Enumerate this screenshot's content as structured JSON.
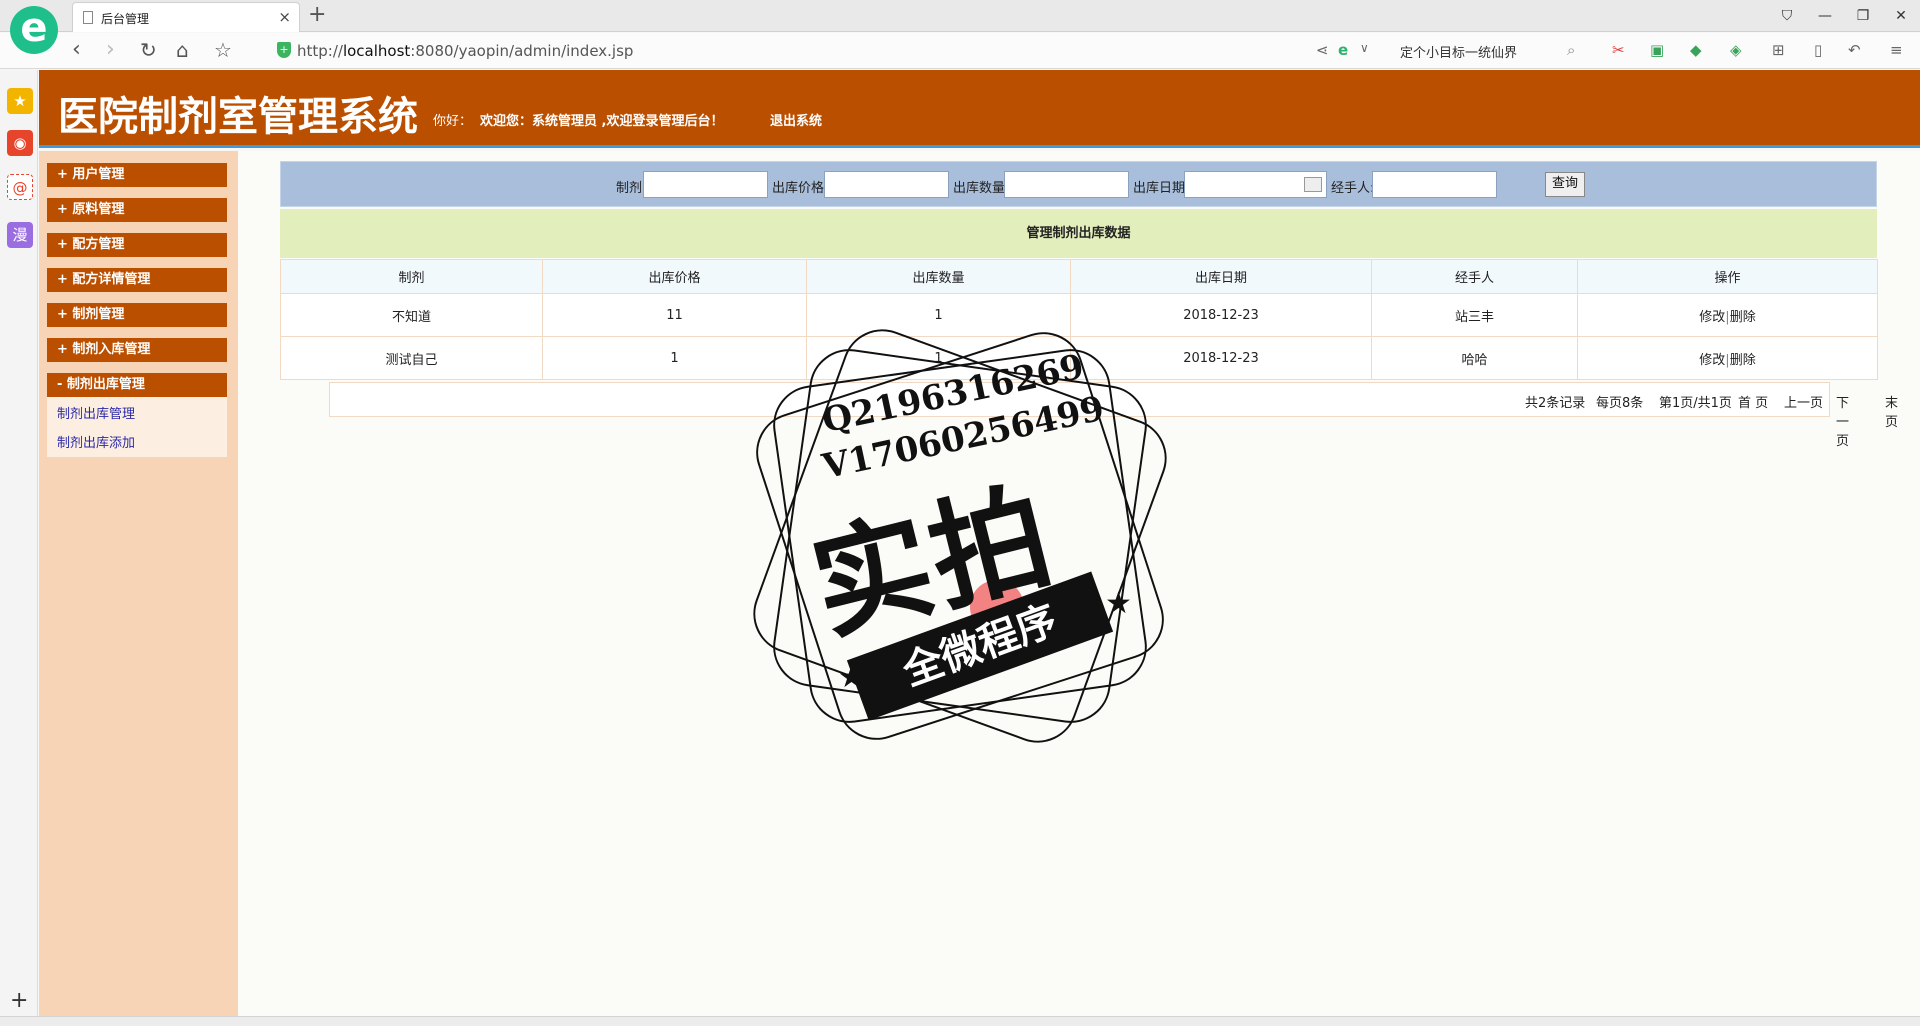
{
  "browser": {
    "tab_title": "后台管理",
    "url_prefix": "http://",
    "url_host": "localhost",
    "url_rest": ":8080/yaopin/admin/index.jsp",
    "search_placeholder": "定个小目标一统仙界",
    "newtab_glyph": "+",
    "close_glyph": "×"
  },
  "header": {
    "title": "医院制剂室管理系统",
    "greeting": "你好：",
    "welcome": "欢迎您：系统管理员 ,欢迎登录管理后台！",
    "logout": "退出系统"
  },
  "sidebar": {
    "items": [
      {
        "label": "+ 用户管理"
      },
      {
        "label": "+ 原料管理"
      },
      {
        "label": "+ 配方管理"
      },
      {
        "label": "+ 配方详情管理"
      },
      {
        "label": "+ 制剂管理"
      },
      {
        "label": "+ 制剂入库管理"
      },
      {
        "label": "- 制剂出库管理"
      }
    ],
    "subitems": [
      {
        "label": "制剂出库管理"
      },
      {
        "label": "制剂出库添加"
      }
    ]
  },
  "search": {
    "f1": "制剂:",
    "f2": "出库价格:",
    "f3": "出库数量:",
    "f4": "出库日期:",
    "f5": "经手人:",
    "button": "查询"
  },
  "table": {
    "title": "管理制剂出库数据",
    "headers": [
      "制剂",
      "出库价格",
      "出库数量",
      "出库日期",
      "经手人",
      "操作"
    ],
    "rows": [
      {
        "c0": "不知道",
        "c1": "11",
        "c2": "1",
        "c3": "2018-12-23",
        "c4": "站三丰",
        "edit": "修改",
        "sep": "|",
        "del": "删除"
      },
      {
        "c0": "测试自己",
        "c1": "1",
        "c2": "1",
        "c3": "2018-12-23",
        "c4": "哈哈",
        "edit": "修改",
        "sep": "|",
        "del": "删除"
      }
    ]
  },
  "pager": {
    "total": "共2条记录",
    "per_page": "每页8条",
    "page": "第1页/共1页",
    "first": "首 页",
    "prev": "上一页",
    "next": "下一页",
    "last": "末 页"
  },
  "watermark": {
    "qq": "Q2196316269",
    "wx": "V17060256499",
    "big": "实拍",
    "ribbon": "全微程序"
  },
  "colors": {
    "header_bg": "#bb4f00",
    "sidebar_bg": "#f8d4b6",
    "search_bar_bg": "#a8bedb",
    "title_row_bg": "#e2efbd"
  }
}
